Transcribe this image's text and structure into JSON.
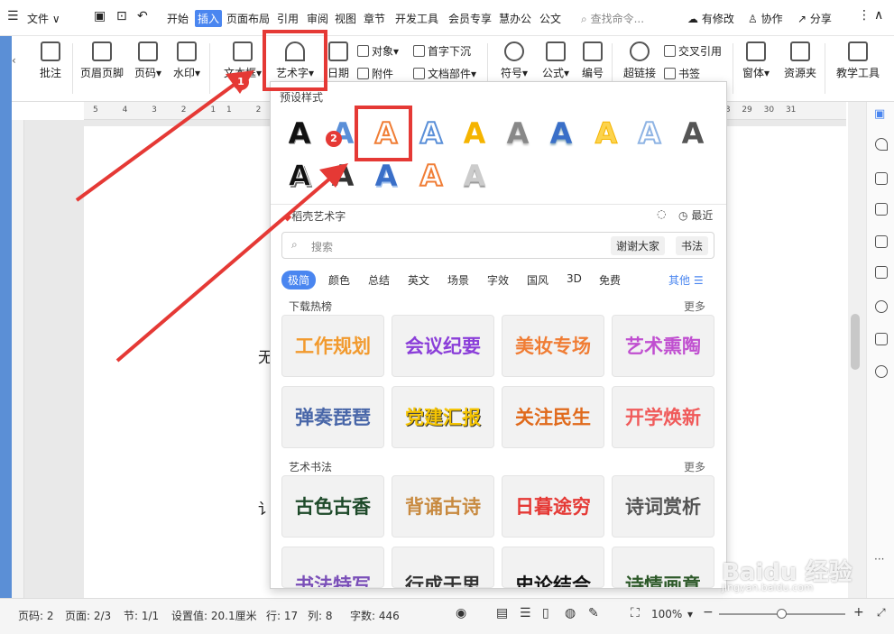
{
  "menubar": {
    "file_label": "文件",
    "items": [
      "开始",
      "插入",
      "页面布局",
      "引用",
      "审阅",
      "视图",
      "章节",
      "开发工具",
      "会员专享",
      "慧办公",
      "公文"
    ],
    "search_placeholder": "查找命令...",
    "right": {
      "changes": "有修改",
      "collab": "协作",
      "share": "分享"
    }
  },
  "ribbon": {
    "comment": "批注",
    "header_footer": "页眉页脚",
    "page_number": "页码",
    "watermark": "水印",
    "textbox": "文本框",
    "wordart": "艺术字",
    "date": "日期",
    "object": "对象",
    "attachment": "附件",
    "dropcap": "首字下沉",
    "doc_parts": "文档部件",
    "symbol": "符号",
    "formula": "公式",
    "numbering": "编号",
    "hyperlink": "超链接",
    "cross_ref": "交叉引用",
    "bookmark": "书签",
    "window": "窗体",
    "resources": "资源夹",
    "teach_tools": "教学工具"
  },
  "ruler": {
    "left_ticks": [
      "5",
      "4",
      "3",
      "2",
      "1",
      "1",
      "2",
      "3"
    ],
    "right_ticks": [
      "29",
      "30",
      "31"
    ],
    "right_ticks_left": [
      "28"
    ]
  },
  "document": {
    "partial_text_1": "无",
    "partial_text_2": "讠"
  },
  "dropdown": {
    "preset_title": "预设样式",
    "presets_row1": [
      "A",
      "A",
      "A",
      "A",
      "A",
      "A",
      "A",
      "A",
      "A",
      "A"
    ],
    "presets_row2": [
      "A",
      "A",
      "A",
      "A",
      "A"
    ],
    "wordart_title": "稻壳艺术字",
    "recent_label": "最近",
    "search_placeholder": "搜索",
    "search_chips": [
      "谢谢大家",
      "书法"
    ],
    "tags": [
      "极简",
      "颜色",
      "总结",
      "英文",
      "场景",
      "字效",
      "国风",
      "3D",
      "免费"
    ],
    "other_label": "其他",
    "download_title": "下载热榜",
    "more_label": "更多",
    "download_tiles": [
      "工作规划",
      "会议纪要",
      "美妆专场",
      "艺术熏陶",
      "弹奏琵琶",
      "党建汇报",
      "关注民生",
      "开学焕新"
    ],
    "calligraphy_title": "艺术书法",
    "calligraphy_more": "更多",
    "calligraphy_tiles": [
      "古色古香",
      "背诵古诗",
      "日暮途穷",
      "诗词赏析",
      "书法特写",
      "行成于思",
      "史论结合",
      "诗情画意"
    ]
  },
  "annotations": {
    "badge1": "1",
    "badge2": "2",
    "highlight_color": "#e53935"
  },
  "statusbar": {
    "page_code": "页码: 2",
    "pages": "页面: 2/3",
    "section": "节: 1/1",
    "setting": "设置值: 20.1厘米",
    "row": "行: 17",
    "col": "列: 8",
    "word_count": "字数: 446",
    "zoom": "100%"
  },
  "watermark_text": "Baidu 经验",
  "watermark_sub": "jingyan.baidu.com",
  "colors": {
    "accent": "#4a86f0",
    "red": "#e53935"
  }
}
